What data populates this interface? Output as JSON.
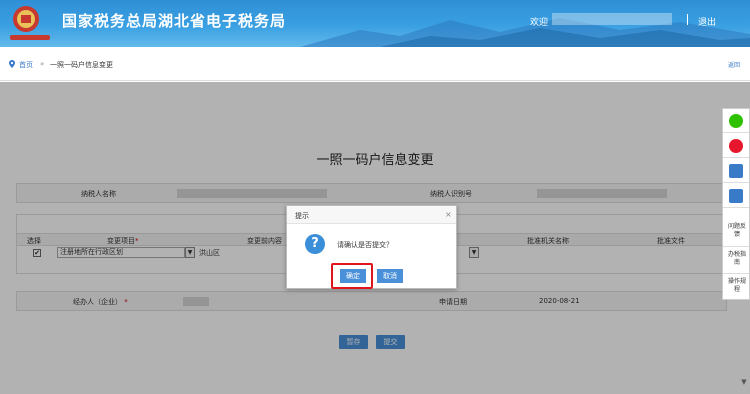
{
  "header": {
    "site_title": "国家税务总局湖北省电子税务局",
    "welcome": "欢迎",
    "logout": "退出",
    "accent_color": "#2f8fd6"
  },
  "breadcrumb": {
    "home": "首页",
    "separator": "»",
    "current": "一照一码户信息变更",
    "back": "返回"
  },
  "form": {
    "title": "一照一码户信息变更",
    "taxpayer_name_label": "纳税人名称",
    "taxpayer_id_label": "纳税人识别号",
    "columns": [
      "选择",
      "变更项目",
      "变更前内容",
      "批准机关名称",
      "批准文件"
    ],
    "row": {
      "checked": "✔",
      "item": "注册地所在行政区划",
      "before": "洪山区"
    },
    "agent_label": "经办人（企业）",
    "required_mark": "*",
    "date_label": "申请日期",
    "date_value": "2020-08-21",
    "save_button": "暂存",
    "submit_button": "提交"
  },
  "side_toolbar": {
    "items": [
      {
        "icon": "wechat-icon",
        "color": "#2dc100"
      },
      {
        "icon": "weibo-icon",
        "color": "#e6162d"
      },
      {
        "icon": "printer-icon",
        "color": "#3a7bc8"
      },
      {
        "icon": "printer-icon",
        "color": "#3a7bc8"
      }
    ],
    "feedback": "问题反馈",
    "guide": "办税指南",
    "manual": "操作规程"
  },
  "dialog": {
    "title": "提示",
    "close": "×",
    "icon": "question-icon",
    "message": "请确认是否提交？",
    "ok": "确定",
    "cancel": "取消",
    "highlight_color": "#e0161c"
  }
}
